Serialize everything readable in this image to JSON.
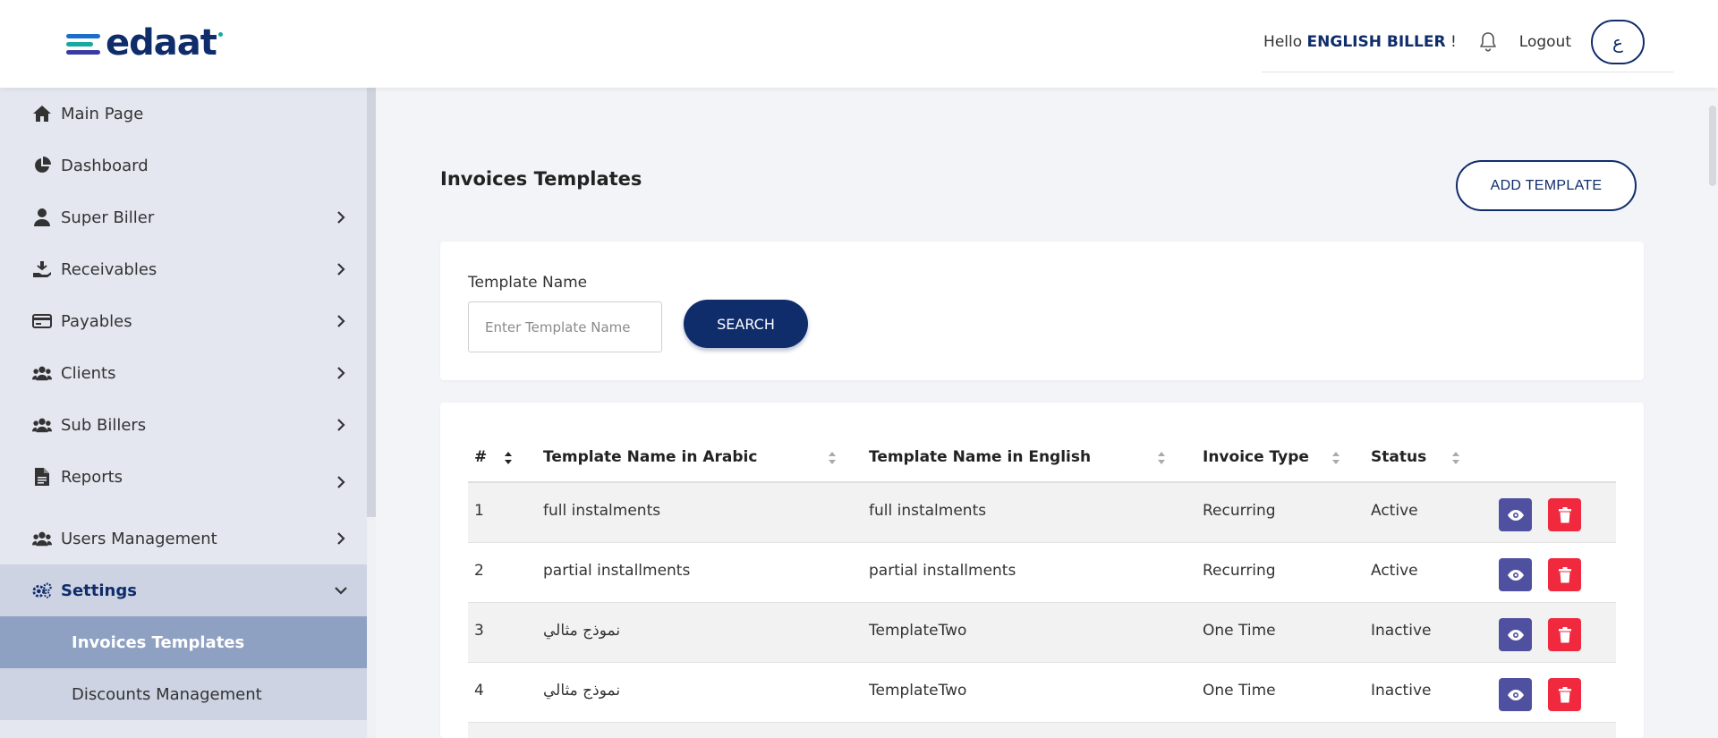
{
  "header": {
    "logo_text": "edaat",
    "greeting_prefix": "Hello",
    "user_name": "ENGLISH BILLER",
    "greeting_suffix": "!",
    "logout_label": "Logout",
    "language_label": "ع"
  },
  "sidebar": {
    "items": [
      {
        "label": "Main Page",
        "icon": "home-icon",
        "has_chevron": false
      },
      {
        "label": "Dashboard",
        "icon": "pie-chart-icon",
        "has_chevron": false
      },
      {
        "label": "Super Biller",
        "icon": "user-icon",
        "has_chevron": true
      },
      {
        "label": "Receivables",
        "icon": "hand-coin-icon",
        "has_chevron": true
      },
      {
        "label": "Payables",
        "icon": "credit-card-icon",
        "has_chevron": true
      },
      {
        "label": "Clients",
        "icon": "users-icon",
        "has_chevron": true
      },
      {
        "label": "Sub Billers",
        "icon": "users-icon",
        "has_chevron": true
      },
      {
        "label": "Reports",
        "icon": "document-icon",
        "has_chevron": true
      },
      {
        "label": "Users Management",
        "icon": "users-icon",
        "has_chevron": true
      },
      {
        "label": "Settings",
        "icon": "gears-icon",
        "has_chevron": true,
        "expanded": true
      }
    ],
    "settings_subitems": [
      {
        "label": "Invoices Templates",
        "current": true
      },
      {
        "label": "Discounts Management",
        "current": false
      }
    ]
  },
  "main": {
    "title": "Invoices Templates",
    "add_button_label": "ADD TEMPLATE",
    "search": {
      "label": "Template Name",
      "placeholder": "Enter Template Name",
      "value": "",
      "button_label": "SEARCH"
    },
    "table": {
      "columns": [
        "#",
        "Template Name in Arabic",
        "Template Name in English",
        "Invoice Type",
        "Status"
      ],
      "rows": [
        {
          "num": "1",
          "name_ar": "full instalments",
          "name_en": "full instalments",
          "type": "Recurring",
          "status": "Active"
        },
        {
          "num": "2",
          "name_ar": "partial installments",
          "name_en": "partial installments",
          "type": "Recurring",
          "status": "Active"
        },
        {
          "num": "3",
          "name_ar": "نموذج مثالي",
          "name_en": "TemplateTwo",
          "type": "One Time",
          "status": "Inactive"
        },
        {
          "num": "4",
          "name_ar": "نموذج مثالي",
          "name_en": "TemplateTwo",
          "type": "One Time",
          "status": "Inactive"
        }
      ]
    }
  },
  "colors": {
    "brand_navy": "#0f2c6b",
    "view_button": "#5050a0",
    "delete_button": "#f0293e",
    "sidebar_bg": "#e4e7f0",
    "sidebar_active": "#cdd3e3",
    "sidebar_current": "#8fa1c2"
  }
}
